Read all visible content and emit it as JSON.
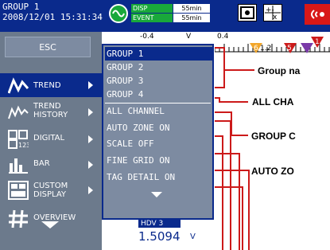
{
  "status_bar": {
    "group": "GROUP 1",
    "datetime": "2008/12/01 15:31:34",
    "disp_label": "DISP",
    "disp_value": "55min",
    "event_label": "EVENT",
    "event_value": "55min"
  },
  "left_menu": {
    "esc": "ESC",
    "items": [
      {
        "label": "TREND",
        "icon": "trend-icon"
      },
      {
        "label": "TREND\nHISTORY",
        "icon": "trend-history-icon"
      },
      {
        "label": "DIGITAL",
        "icon": "digital-icon"
      },
      {
        "label": "BAR",
        "icon": "bar-chart-icon"
      },
      {
        "label": "CUSTOM\nDISPLAY",
        "icon": "custom-display-icon"
      },
      {
        "label": "OVERVIEW",
        "icon": "overview-icon"
      }
    ]
  },
  "scale": {
    "neg": "-0.4",
    "unit": "V",
    "pos": "0.4",
    "markers": [
      "6",
      "1.2",
      "5",
      "1"
    ]
  },
  "submenu": {
    "items": [
      "GROUP 1",
      "GROUP 2",
      "GROUP 3",
      "GROUP 4",
      "ALL CHANNEL",
      "AUTO ZONE ON",
      "SCALE OFF",
      "FINE GRID ON",
      "TAG DETAIL ON"
    ]
  },
  "digital": {
    "tag": "HDV 3",
    "value": "1.5094",
    "unit": "V"
  },
  "annotations": {
    "group_names": "Group na",
    "all_channel": "ALL CHA",
    "group_c": "GROUP C",
    "auto_zone": "AUTO ZO"
  },
  "colors": {
    "status_bar": "#0a2a8c",
    "menu_bg": "#6c7a8c",
    "highlight": "#0a2a8c",
    "disp_green": "#19a83b",
    "alarm_red": "#d81818",
    "marker_orange": "#f2a62a",
    "marker_red": "#cc1a1a",
    "marker_purple": "#7a3aa8"
  }
}
